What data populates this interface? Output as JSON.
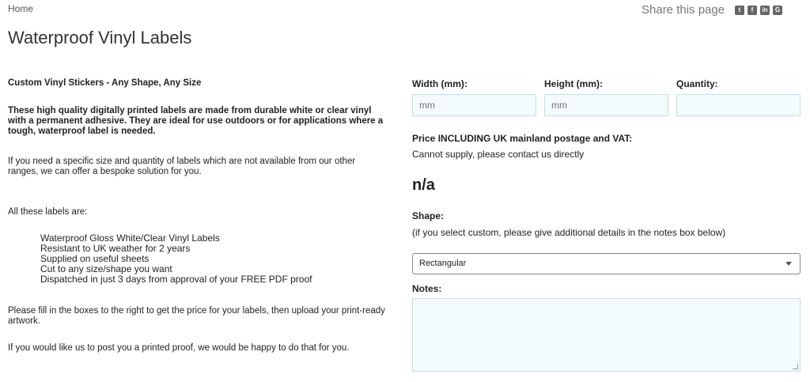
{
  "breadcrumb": "Home",
  "share": {
    "label": "Share this page",
    "icons": [
      "twitter-icon",
      "facebook-icon",
      "linkedin-icon",
      "google-plus-icon"
    ]
  },
  "title": "Waterproof Vinyl Labels",
  "left": {
    "heading": "Custom Vinyl Stickers - Any Shape, Any Size",
    "intro": "These high quality digitally printed labels are made from durable white or clear vinyl with a permanent adhesive. They are ideal for use outdoors or for applications where a tough, waterproof label is needed.",
    "bespoke": "If you need a specific size and quantity of labels which are not available from our other ranges, we can offer a bespoke solution for you.",
    "all_these": "All these labels are:",
    "features": [
      "Waterproof Gloss White/Clear Vinyl Labels",
      "Resistant to UK weather for 2 years",
      "Supplied on useful sheets",
      "Cut to any size/shape you want",
      "Dispatched in just 3 days from approval of your FREE PDF proof"
    ],
    "fill_in": "Please fill in the boxes to the right to get the price for your labels, then upload your print-ready artwork.",
    "proof": "If you would like us to post you a printed proof, we would be happy to do that for you."
  },
  "form": {
    "width_label": "Width (mm):",
    "width_placeholder": "mm",
    "height_label": "Height (mm):",
    "height_placeholder": "mm",
    "quantity_label": "Quantity:",
    "quantity_placeholder": "",
    "price_label": "Price INCLUDING UK mainland postage and VAT:",
    "price_note": "Cannot supply, please contact us directly",
    "price_value": "n/a",
    "shape_label": "Shape:",
    "shape_hint": "(if you select custom, please give additional details in the notes box below)",
    "shape_selected": "Rectangular",
    "notes_label": "Notes:"
  }
}
